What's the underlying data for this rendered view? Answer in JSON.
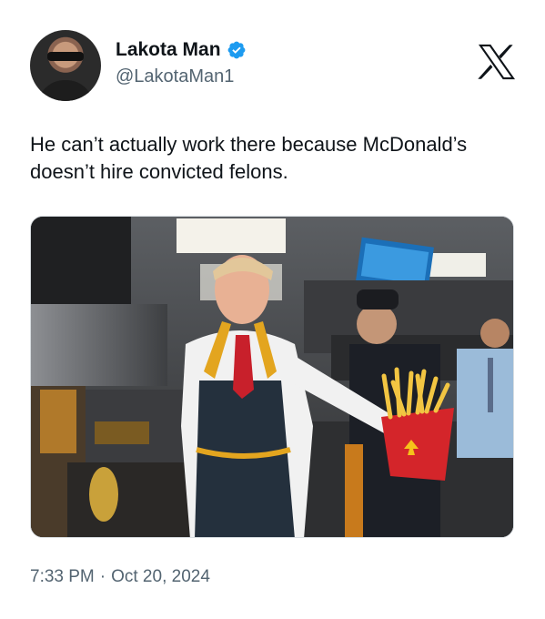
{
  "author": {
    "display_name": "Lakota Man",
    "handle": "@LakotaMan1",
    "verified": true
  },
  "icons": {
    "verified": "verified-badge-icon",
    "platform": "x-logo-icon"
  },
  "tweet": {
    "text": "He can’t actually work there because McDonald’s doesn’t hire convicted felons."
  },
  "media": {
    "type": "photo",
    "alt": ""
  },
  "meta": {
    "time": "7:33 PM",
    "separator": "·",
    "date": "Oct 20, 2024"
  },
  "colors": {
    "text_primary": "#0f1419",
    "text_secondary": "#536471",
    "verified_blue": "#1d9bf0"
  }
}
